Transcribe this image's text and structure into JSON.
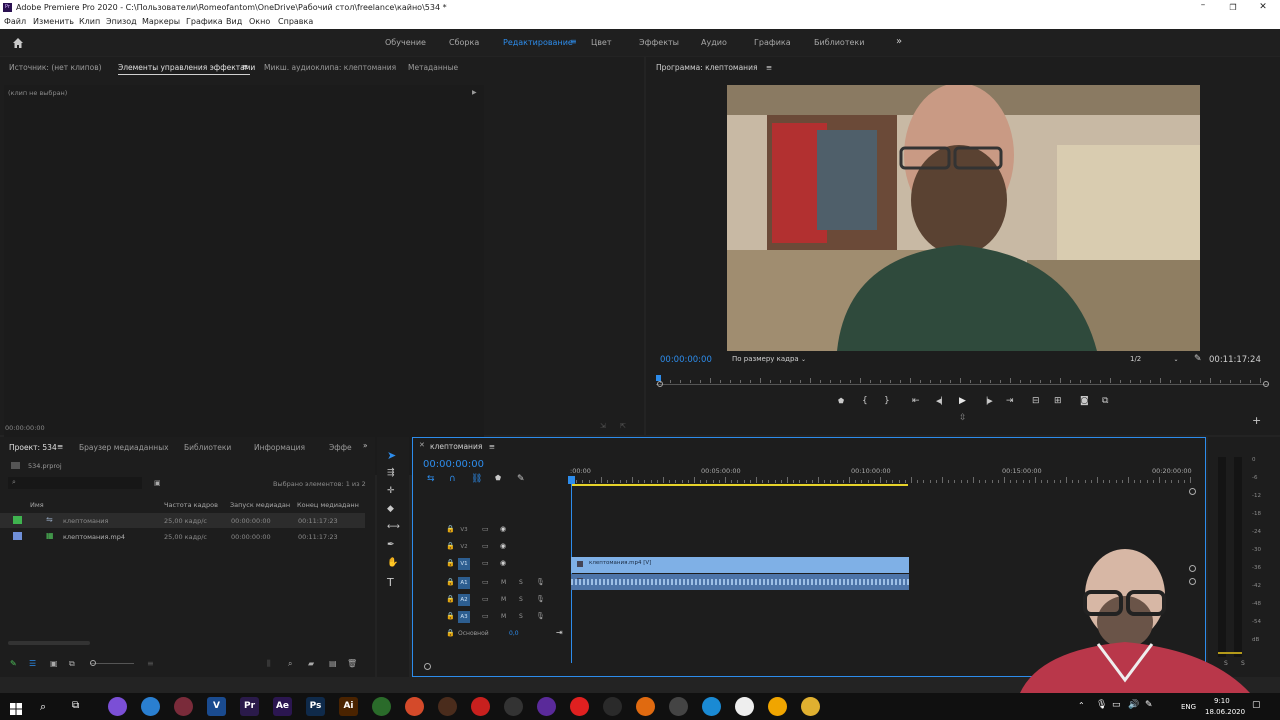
{
  "window": {
    "title": "Adobe Premiere Pro 2020 - C:\\Пользователи\\Romeofantom\\OneDrive\\Рабочий стол\\freelance\\кайно\\534 *",
    "app_glyph": "Pr"
  },
  "menu": [
    "Файл",
    "Изменить",
    "Клип",
    "Эпизод",
    "Маркеры",
    "Графика",
    "Вид",
    "Окно",
    "Справка"
  ],
  "workspaces": {
    "items": [
      "Обучение",
      "Сборка",
      "Редактирование",
      "Цвет",
      "Эффекты",
      "Аудио",
      "Графика",
      "Библиотеки"
    ],
    "active": "Редактирование",
    "more": "»"
  },
  "source_panel": {
    "tabs": [
      "Источник: (нет клипов)",
      "Элементы управления эффектами",
      "Микш. аудиоклипа: клептомания",
      "Метаданные"
    ],
    "active_tab": "Элементы управления эффектами",
    "no_clip": "(клип не выбран)",
    "timecode": "00:00:00:00"
  },
  "program": {
    "title": "Программа: клептомания",
    "timecode": "00:00:00:00",
    "fit": "По размеру кадра",
    "resolution": "1/2",
    "duration": "00:11:17:24"
  },
  "project": {
    "tabs": [
      "Проект: 534",
      "Браузер медиаданных",
      "Библиотеки",
      "Информация",
      "Эффе"
    ],
    "file": "534.prproj",
    "selected": "Выбрано элементов: 1 из 2",
    "columns": [
      "Имя",
      "Частота кадров",
      "Запуск медиадан",
      "Конец медиаданн"
    ],
    "rows": [
      {
        "name": "клептомания",
        "fps": "25,00 кадр/с",
        "start": "00:00:00:00",
        "end": "00:11:17:23",
        "color": "#3fb34f"
      },
      {
        "name": "клептомания.mp4",
        "fps": "25,00 кадр/с",
        "start": "00:00:00:00",
        "end": "00:11:17:23",
        "color": "#6f8fd8"
      }
    ]
  },
  "timeline": {
    "sequence": "клептомания",
    "timecode": "00:00:00:00",
    "ruler": [
      ":00:00",
      "00:05:00:00",
      "00:10:00:00",
      "00:15:00:00",
      "00:20:00:00"
    ],
    "video_tracks": [
      "V3",
      "V2",
      "V1"
    ],
    "audio_tracks": [
      "A1",
      "A2",
      "A3"
    ],
    "master": "Основной",
    "master_value": "0,0",
    "clip_label": "клептомания.mp4 [V]",
    "m_label": "M",
    "s_label": "S"
  },
  "meters": {
    "scale": [
      "0",
      "-6",
      "-12",
      "-18",
      "-24",
      "-30",
      "-36",
      "-42",
      "-48",
      "-54",
      "dB"
    ],
    "s_labels": [
      "S",
      "S"
    ]
  },
  "taskbar": {
    "lang": "ENG",
    "time": "9:10",
    "date": "18.06.2020",
    "apps": [
      {
        "label": "",
        "color": "#7b4fd6"
      },
      {
        "label": "",
        "color": "#2a7fd0"
      },
      {
        "label": "",
        "color": "#7a2b3a"
      },
      {
        "label": "V",
        "color": "#1a4b8f"
      },
      {
        "label": "Pr",
        "color": "#2a1a4a"
      },
      {
        "label": "Ae",
        "color": "#2b1650"
      },
      {
        "label": "Ps",
        "color": "#0f2a4a"
      },
      {
        "label": "Ai",
        "color": "#4a2300"
      },
      {
        "label": "",
        "color": "#2a6b2a"
      },
      {
        "label": "",
        "color": "#d44a2a"
      },
      {
        "label": "",
        "color": "#4a2c1c"
      },
      {
        "label": "",
        "color": "#c8201e"
      },
      {
        "label": "",
        "color": "#333333"
      },
      {
        "label": "",
        "color": "#5a2a9a"
      },
      {
        "label": "",
        "color": "#e02020"
      },
      {
        "label": "",
        "color": "#2a2a2a"
      },
      {
        "label": "",
        "color": "#e06a10"
      },
      {
        "label": "",
        "color": "#444444"
      },
      {
        "label": "",
        "color": "#1a8ad4"
      },
      {
        "label": "",
        "color": "#eeeeee"
      },
      {
        "label": "",
        "color": "#f0a500"
      },
      {
        "label": "",
        "color": "#e0b030"
      }
    ]
  },
  "colors": {
    "accent": "#2d8ceb",
    "clip": "#7fb0e6",
    "playhead": "#2d8ceb",
    "workarea": "#e6d22a"
  }
}
